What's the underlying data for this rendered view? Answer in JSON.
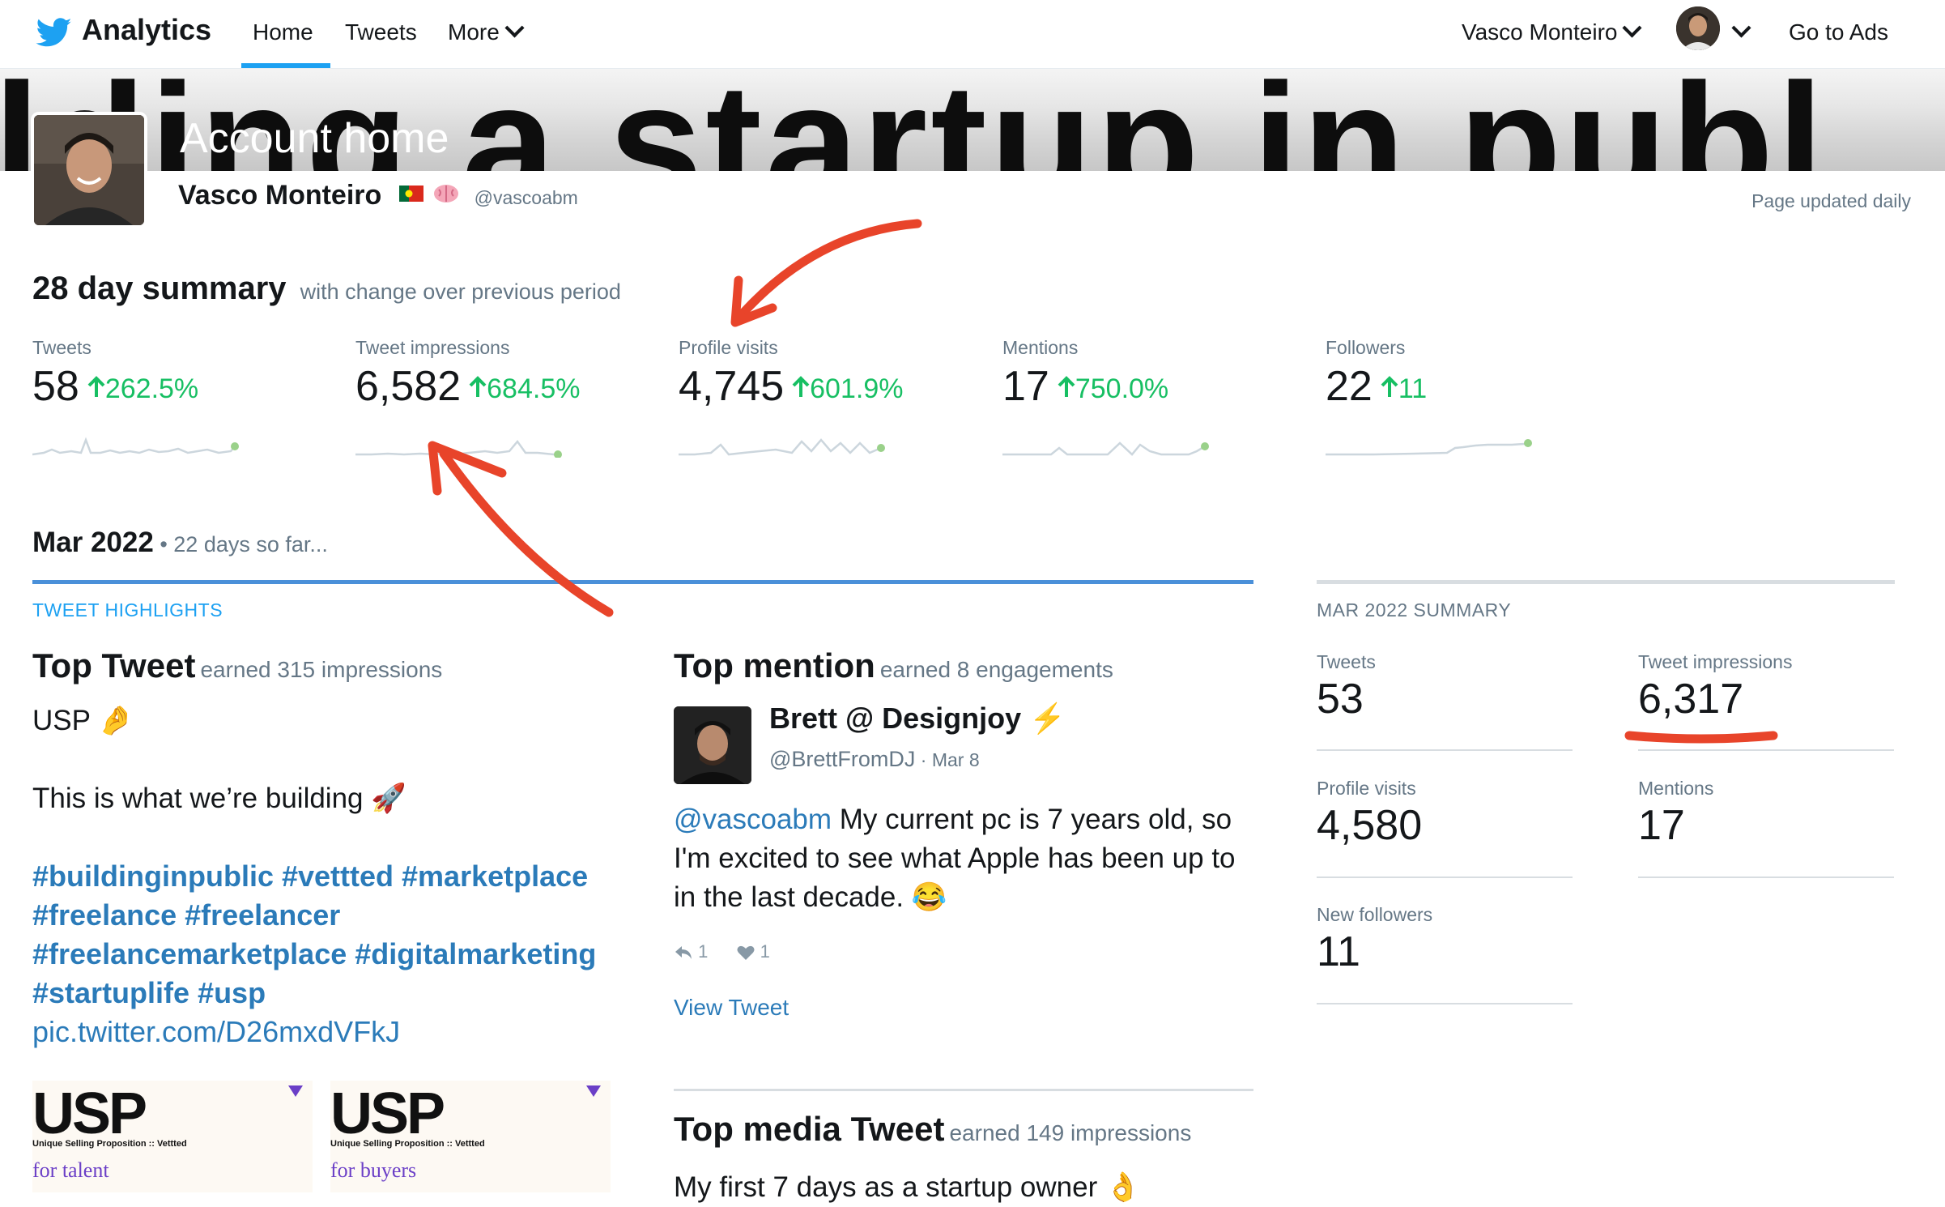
{
  "nav": {
    "brand": "Analytics",
    "home": "Home",
    "tweets": "Tweets",
    "more": "More",
    "user_menu": "Vasco Monteiro",
    "go_to_ads": "Go to Ads"
  },
  "banner": {
    "background_text": "ilding a startup in publ",
    "title": "Account home"
  },
  "profile": {
    "name": "Vasco Monteiro",
    "handle": "@vascoabm",
    "page_updated": "Page updated daily"
  },
  "summary": {
    "title": "28 day summary",
    "subtitle": "with change over previous period",
    "metrics": [
      {
        "label": "Tweets",
        "value": "58",
        "change": "262.5%"
      },
      {
        "label": "Tweet impressions",
        "value": "6,582",
        "change": "684.5%"
      },
      {
        "label": "Profile visits",
        "value": "4,745",
        "change": "601.9%"
      },
      {
        "label": "Mentions",
        "value": "17",
        "change": "750.0%"
      },
      {
        "label": "Followers",
        "value": "22",
        "change": "11"
      }
    ]
  },
  "month": {
    "title": "Mar 2022",
    "subtitle": " • 22 days so far..."
  },
  "highlights": {
    "label": "TWEET HIGHLIGHTS",
    "top_tweet": {
      "title": "Top Tweet",
      "subtitle": "earned 315 impressions",
      "line1": "USP 🤌",
      "line2": "This is what we’re building 🚀",
      "hashtags_1": "#buildinginpublic #vettted #marketplace",
      "hashtags_2": "#freelance #freelancer",
      "hashtags_3": "#freelancemarketplace #digitalmarketing",
      "hashtags_4": "#startuplife #usp",
      "pic_link": "pic.twitter.com/D26mxdVFkJ",
      "images": [
        {
          "big": "USP",
          "small": "Unique Selling Proposition :: Vettted",
          "for": "for talent"
        },
        {
          "big": "USP",
          "small": "Unique Selling Proposition :: Vettted",
          "for": "for buyers"
        }
      ]
    },
    "top_mention": {
      "title": "Top mention",
      "subtitle": "earned 8 engagements",
      "name": "Brett @ Designjoy ⚡",
      "handle": "@BrettFromDJ",
      "date": " · Mar 8",
      "mention": "@vascoabm",
      "text": " My current pc is 7 years old, so I'm excited to see what Apple has been up to in the last decade. 😂",
      "replies": "1",
      "likes": "1",
      "view_tweet": "View Tweet"
    },
    "top_media": {
      "title": "Top media Tweet",
      "subtitle": "earned 149 impressions",
      "text": "My first 7 days as a startup owner 👌"
    }
  },
  "month_summary": {
    "label": "MAR 2022 SUMMARY",
    "items": [
      {
        "label": "Tweets",
        "value": "53"
      },
      {
        "label": "Tweet impressions",
        "value": "6,317"
      },
      {
        "label": "Profile visits",
        "value": "4,580"
      },
      {
        "label": "Mentions",
        "value": "17"
      },
      {
        "label": "New followers",
        "value": "11"
      }
    ]
  },
  "colors": {
    "twitter_blue": "#1da1f2",
    "link_blue": "#2b7bb9",
    "positive_green": "#17bf63",
    "annotation_red": "#e8442a"
  }
}
